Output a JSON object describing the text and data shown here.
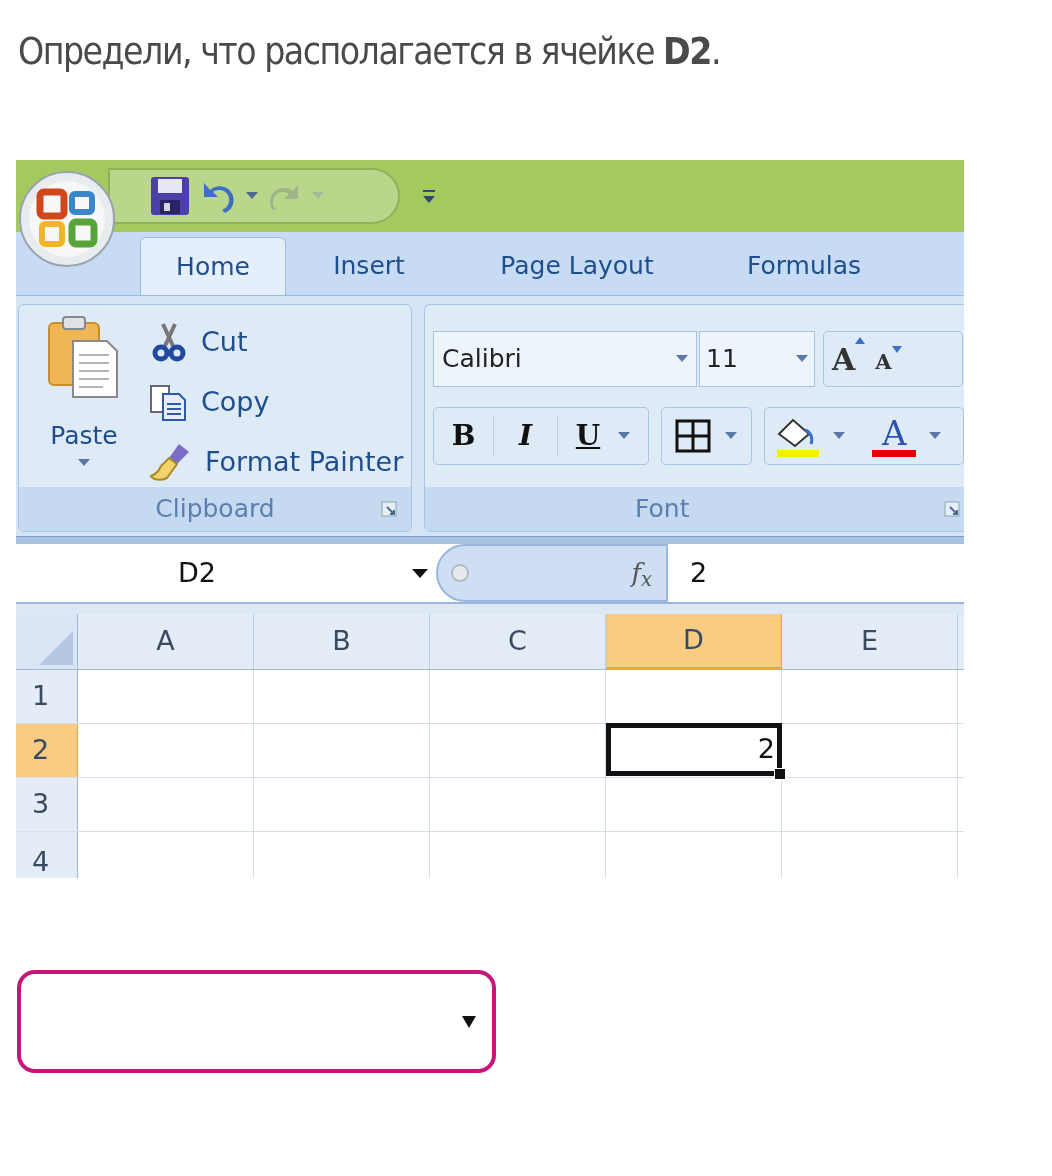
{
  "question": "Определи, что располагается в ячейке **D2**.",
  "excel": {
    "tabs": [
      {
        "label": "Home",
        "selected": true
      },
      {
        "label": "Insert",
        "selected": false
      },
      {
        "label": "Page Layout",
        "selected": false
      },
      {
        "label": "Formulas",
        "selected": false
      }
    ],
    "clipboard": {
      "paste": "Paste",
      "cut": "Cut",
      "copy": "Copy",
      "format_painter": "Format Painter",
      "group_label": "Clipboard"
    },
    "font": {
      "font_name": "Calibri",
      "font_size": "11",
      "grow": "A",
      "shrink": "A",
      "bold": "B",
      "italic": "I",
      "underline": "U",
      "font_color": "A",
      "group_label": "Font"
    },
    "name_box": "D2",
    "fx": "f$_{x}$",
    "formula": "2",
    "columns": [
      {
        "label": "A",
        "selected": false
      },
      {
        "label": "B",
        "selected": false
      },
      {
        "label": "C",
        "selected": false
      },
      {
        "label": "D",
        "selected": true
      },
      {
        "label": "E",
        "selected": false
      }
    ],
    "rows": [
      {
        "label": "1",
        "selected": false,
        "cells": [
          {
            "active": false
          },
          {
            "active": false
          },
          {
            "active": false
          },
          {
            "active": false
          },
          {
            "active": false
          }
        ]
      },
      {
        "label": "2",
        "selected": true,
        "cells": [
          {
            "active": false
          },
          {
            "active": false
          },
          {
            "active": false
          },
          {
            "value": "2",
            "active": true
          },
          {
            "active": false
          }
        ]
      },
      {
        "label": "3",
        "selected": false,
        "cells": [
          {
            "active": false
          },
          {
            "active": false
          },
          {
            "active": false
          },
          {
            "active": false
          },
          {
            "active": false
          }
        ]
      },
      {
        "label": "4",
        "selected": false,
        "cells": [
          {
            "active": false
          },
          {
            "active": false
          },
          {
            "active": false
          },
          {
            "active": false
          },
          {
            "active": false
          }
        ]
      }
    ]
  }
}
